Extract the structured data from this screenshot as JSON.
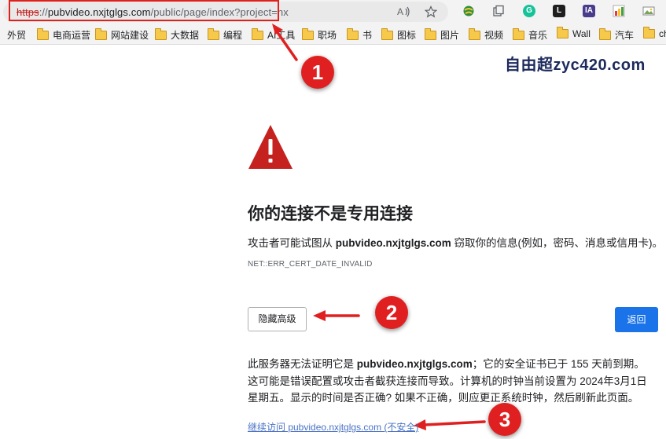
{
  "address_bar": {
    "scheme": "https",
    "separator": "://",
    "host": "pubvideo.nxjtglgs.com",
    "path": "/public/page/index?project=nx",
    "icons": [
      "read-aloud-icon",
      "favorite-star-icon"
    ]
  },
  "extensions": [
    "extension-globe-icon",
    "extension-copy-icon",
    "extension-grammarly-icon",
    "extension-l-icon",
    "extension-ia-icon",
    "extension-color-icon",
    "extension-image-icon"
  ],
  "bookmarks": [
    {
      "label": "外贸",
      "folder": false
    },
    {
      "label": "电商运营",
      "folder": true
    },
    {
      "label": "网站建设",
      "folder": true
    },
    {
      "label": "大数据",
      "folder": true
    },
    {
      "label": "编程",
      "folder": true
    },
    {
      "label": "AI工具",
      "folder": true
    },
    {
      "label": "职场",
      "folder": true
    },
    {
      "label": "书",
      "folder": true
    },
    {
      "label": "图标",
      "folder": true
    },
    {
      "label": "图片",
      "folder": true
    },
    {
      "label": "视频",
      "folder": true
    },
    {
      "label": "音乐",
      "folder": true
    },
    {
      "label": "Wall",
      "folder": true
    },
    {
      "label": "汽车",
      "folder": true
    },
    {
      "label": "ch",
      "folder": true
    }
  ],
  "watermark": "自由超zyc420.com",
  "annotations": [
    "1",
    "2",
    "3"
  ],
  "annotation_color": "#e02020",
  "error_page": {
    "icon": "warning-triangle-icon",
    "icon_color": "#c5221f",
    "title": "你的连接不是专用连接",
    "desc_prefix": "攻击者可能试图从 ",
    "desc_host": "pubvideo.nxjtglgs.com",
    "desc_suffix": " 窃取你的信息(例如，密码、消息或信用卡)。",
    "error_code": "NET::ERR_CERT_DATE_INVALID",
    "hide_advanced_label": "隐藏高级",
    "back_label": "返回",
    "back_color": "#1a73e8",
    "details_prefix": "此服务器无法证明它是 ",
    "details_host": "pubvideo.nxjtglgs.com",
    "details_suffix": "；它的安全证书已于 155 天前到期。这可能是错误配置或攻击者截获连接而导致。计算机的时钟当前设置为 2024年3月1日星期五。显示的时间是否正确? 如果不正确，则应更正系统时钟，然后刷新此页面。",
    "proceed_label": "继续访问 pubvideo.nxjtglgs.com (不安全)"
  }
}
